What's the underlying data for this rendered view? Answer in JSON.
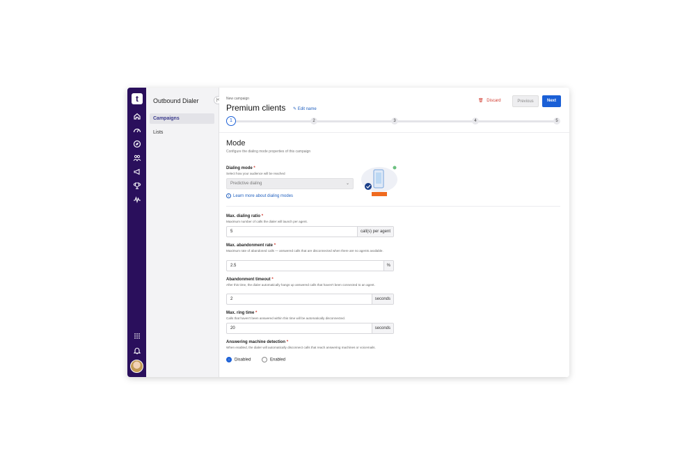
{
  "sidebar": {
    "title": "Outbound Dialer",
    "collapse_icon": "collapse-left-icon",
    "items": [
      {
        "label": "Campaigns",
        "active": true
      },
      {
        "label": "Lists",
        "active": false
      }
    ]
  },
  "rail": {
    "logo": "t",
    "icons": [
      "home-icon",
      "dashboard-icon",
      "compass-icon",
      "people-icon",
      "megaphone-icon",
      "trophy-icon",
      "analytics-icon",
      "apps-grid-icon",
      "bell-icon"
    ]
  },
  "header": {
    "breadcrumb": "New campaign",
    "title": "Premium clients",
    "edit_label": "Edit name",
    "discard_label": "Discard",
    "previous_label": "Previous",
    "next_label": "Next"
  },
  "steps": [
    "1",
    "2",
    "3",
    "4",
    "5"
  ],
  "mode": {
    "title": "Mode",
    "subtitle": "Configure the dialing mode properties of this campaign",
    "dialing_mode": {
      "label": "Dialing mode",
      "hint": "Select how your audience will be reached",
      "value": "Predictive dialing"
    },
    "learn_more": "Learn more about dialing modes"
  },
  "fields": {
    "dialing_ratio": {
      "label": "Max. dialing ratio",
      "hint": "Maximum number of calls the dialer will launch per agent.",
      "value": "5",
      "unit": "call(s) per agent"
    },
    "abandonment_rate": {
      "label": "Max. abandonment rate",
      "hint": "Maximum rate of abandoned calls — answered calls that are disconnected when there are no agents available.",
      "value": "2.5",
      "unit": "%"
    },
    "abandonment_timeout": {
      "label": "Abandonment timeout",
      "hint": "After this time, the dialer automatically hangs up answered calls that haven't been connected to an agent.",
      "value": "2",
      "unit": "seconds"
    },
    "ring_time": {
      "label": "Max. ring time",
      "hint": "Calls that haven't been answered within this time will be automatically disconnected.",
      "value": "20",
      "unit": "seconds"
    },
    "amd": {
      "label": "Answering machine detection",
      "hint": "When enabled, the dialer will automatically disconnect calls that reach answering machines or voicemails.",
      "options": [
        "Disabled",
        "Enabled"
      ],
      "selected": "Disabled"
    }
  },
  "required_mark": "*",
  "colors": {
    "rail": "#2a0f5c",
    "primary": "#1a5fd6",
    "danger": "#d13a2f"
  }
}
